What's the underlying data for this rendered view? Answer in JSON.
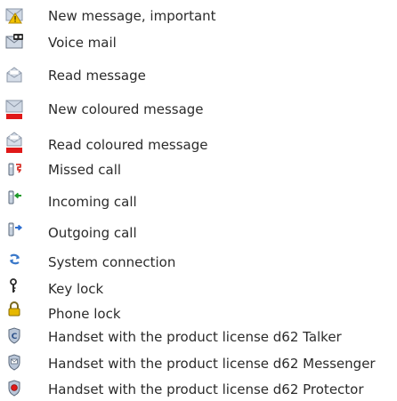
{
  "legend": {
    "items": [
      {
        "icon": "new-message-important-icon",
        "label": "New message, important"
      },
      {
        "icon": "voice-mail-icon",
        "label": "Voice mail"
      },
      {
        "icon": "read-message-icon",
        "label": "Read message"
      },
      {
        "icon": "new-coloured-message-icon",
        "label": "New coloured message"
      },
      {
        "icon": "read-coloured-message-icon",
        "label": "Read coloured message"
      },
      {
        "icon": "missed-call-icon",
        "label": "Missed call"
      },
      {
        "icon": "incoming-call-icon",
        "label": "Incoming call"
      },
      {
        "icon": "outgoing-call-icon",
        "label": "Outgoing call"
      },
      {
        "icon": "system-connection-icon",
        "label": "System connection"
      },
      {
        "icon": "key-lock-icon",
        "label": "Key lock"
      },
      {
        "icon": "phone-lock-icon",
        "label": "Phone lock"
      },
      {
        "icon": "talker-license-icon",
        "label": "Handset with the product license d62 Talker"
      },
      {
        "icon": "messenger-license-icon",
        "label": "Handset with the product license d62 Messenger"
      },
      {
        "icon": "protector-license-icon",
        "label": "Handset with the product license d62 Protector"
      }
    ]
  },
  "colors": {
    "text": "#2b2b2b",
    "envelope": "#c9d3e0",
    "envelope_dark": "#8a96a8",
    "warning_yellow": "#f2c200",
    "coloured_red": "#e01818",
    "missed_red": "#d9342b",
    "incoming_green": "#1f9a2b",
    "outgoing_blue": "#2f6fd0",
    "lock_yellow": "#e6b800"
  }
}
